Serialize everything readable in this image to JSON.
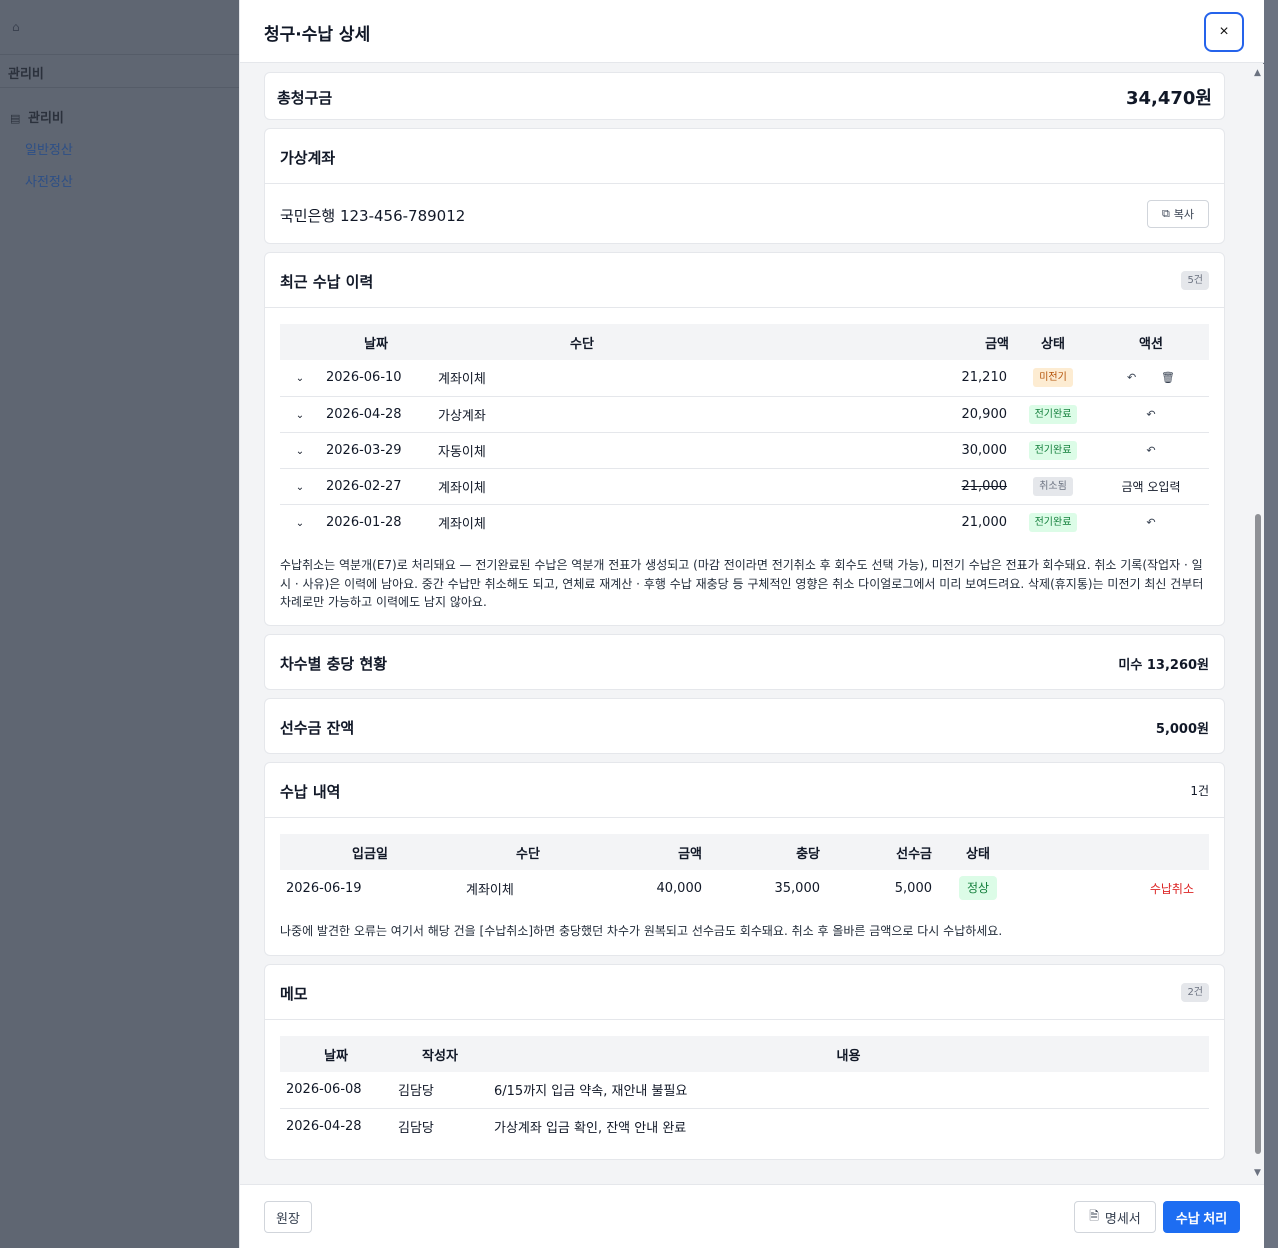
{
  "sidebar": {
    "home_icon": "home-icon",
    "section_title": "관리비",
    "group_label": "관리비",
    "group_icon": "receipt-icon",
    "items": [
      {
        "label": "일반정산"
      },
      {
        "label": "사전정산"
      }
    ]
  },
  "modal": {
    "title": "청구·수납 상세",
    "close_label": "×",
    "total": {
      "label": "총청구금",
      "value": "34,470원"
    },
    "virtual_account": {
      "title": "가상계좌",
      "account": "국민은행 123-456-789012",
      "copy_label": "복사"
    },
    "history": {
      "title": "최근 수납 이력",
      "count": "5건",
      "columns": [
        "날짜",
        "수단",
        "금액",
        "상태",
        "액션"
      ],
      "rows": [
        {
          "date": "2026-06-10",
          "method": "계좌이체",
          "amount": "21,210",
          "status": "미전기",
          "action": ""
        },
        {
          "date": "2026-04-28",
          "method": "가상계좌",
          "amount": "20,900",
          "status": "전기완료",
          "action": ""
        },
        {
          "date": "2026-03-29",
          "method": "자동이체",
          "amount": "30,000",
          "status": "전기완료",
          "action": ""
        },
        {
          "date": "2026-02-27",
          "method": "계좌이체",
          "amount": "21,000",
          "status": "취소됨",
          "action": "금액 오입력"
        },
        {
          "date": "2026-01-28",
          "method": "계좌이체",
          "amount": "21,000",
          "status": "전기완료",
          "action": ""
        }
      ],
      "note": "수납취소는 역분개(E7)로 처리돼요 — 전기완료된 수납은 역분개 전표가 생성되고 (마감 전이라면 전기취소 후 회수도 선택 가능), 미전기 수납은 전표가 회수돼요. 취소 기록(작업자 · 일시 · 사유)은 이력에 남아요. 중간 수납만 취소해도 되고, 연체료 재계산 · 후행 수납 재충당 등 구체적인 영향은 취소 다이얼로그에서 미리 보여드려요. 삭제(휴지통)는 미전기 최신 건부터 차례로만 가능하고 이력에도 남지 않아요."
    },
    "allocation": {
      "title": "차수별 충당 현황",
      "value": "미수 13,260원"
    },
    "prepaid": {
      "title": "선수금 잔액",
      "value": "5,000원"
    },
    "payments": {
      "title": "수납 내역",
      "count": "1건",
      "columns": [
        "입금일",
        "수단",
        "금액",
        "충당",
        "선수금",
        "상태"
      ],
      "rows": [
        {
          "date": "2026-06-19",
          "method": "계좌이체",
          "amount": "40,000",
          "allocated": "35,000",
          "prepaid": "5,000",
          "status": "정상",
          "action": "수납취소"
        }
      ],
      "note": "나중에 발견한 오류는 여기서 해당 건을 [수납취소]하면 충당했던 차수가 원복되고 선수금도 회수돼요. 취소 후 올바른 금액으로 다시 수납하세요."
    },
    "memo": {
      "title": "메모",
      "count": "2건",
      "columns": [
        "날짜",
        "작성자",
        "내용"
      ],
      "rows": [
        {
          "date": "2026-06-08",
          "author": "김담당",
          "content": "6/15까지 입금 약속, 재안내 불필요"
        },
        {
          "date": "2026-04-28",
          "author": "김담당",
          "content": "가상계좌 입금 확인, 잔액 안내 완료"
        }
      ]
    },
    "footer": {
      "ledger_label": "원장",
      "statement_label": "명세서",
      "pay_label": "수납 처리"
    }
  },
  "colors": {
    "primary": "#1d6df2",
    "danger": "#dc2626",
    "success": "#15803d",
    "warning": "#b45309"
  }
}
